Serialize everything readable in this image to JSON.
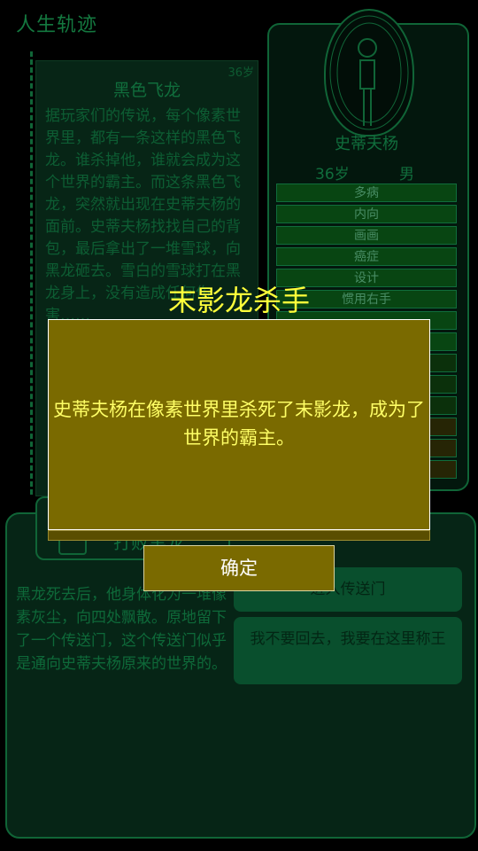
{
  "header": {
    "title": "人生轨迹"
  },
  "timeline": {
    "event": {
      "age": "36岁",
      "title": "黑色飞龙",
      "body": "据玩家们的传说，每个像素世界里，都有一条这样的黑色飞龙。谁杀掉他，谁就会成为这个世界的霸主。而这条黑色飞龙，突然就出现在史蒂夫杨的面前。史蒂夫杨找找自己的背包，最后拿出了一堆雪球，向黑龙砸去。雪白的雪球打在黑龙身上，没有造成任何伤害……"
    }
  },
  "character": {
    "name": "史蒂夫杨",
    "age": "36岁",
    "gender": "男",
    "traits": [
      "多病",
      "内向",
      "画画",
      "癌症",
      "设计",
      "惯用右手",
      "",
      "",
      "",
      "",
      "",
      "",
      "",
      ""
    ]
  },
  "bottom": {
    "tab_label": "打败黑龙",
    "result_text": "黑龙死去后，他身体化为一堆像素灰尘，向四处飘散。原地留下了一个传送门，这个传送门似乎是通向史蒂夫杨原来的世界的。",
    "choices": [
      "进入传送门",
      "我不要回去，我要在这里称王"
    ]
  },
  "dialog": {
    "title": "末影龙杀手",
    "message": "史蒂夫杨在像素世界里杀死了末影龙，成为了世界的霸主。",
    "confirm_label": "确定"
  },
  "colors": {
    "accent": "#1aa85d",
    "dialog_bg": "#7a6a00",
    "dialog_title": "#ffff3a"
  }
}
